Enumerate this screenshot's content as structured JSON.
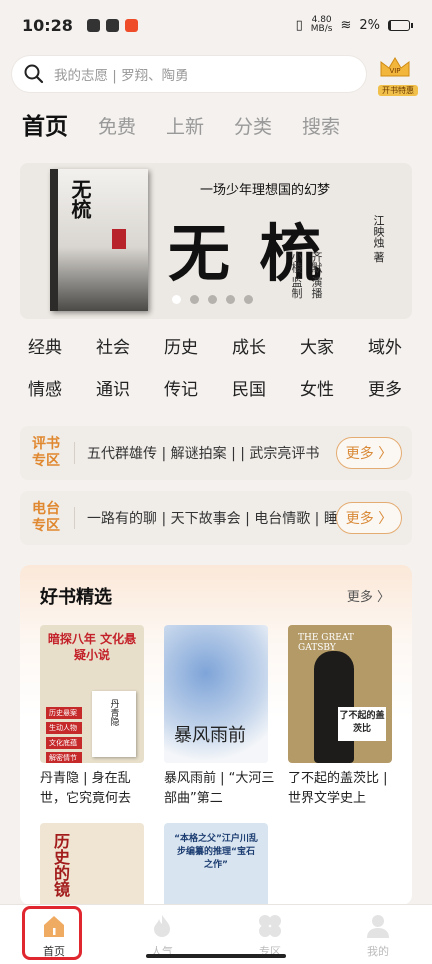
{
  "status": {
    "time": "10:28",
    "net_speed": "4.80",
    "net_unit": "MB/s",
    "battery": "2%"
  },
  "search": {
    "placeholder": "我的志愿 | 罗翔、陶勇"
  },
  "vip": {
    "label": "开书特惠",
    "badge": "VIP"
  },
  "tabs": [
    "首页",
    "免费",
    "上新",
    "分类",
    "搜索"
  ],
  "banner": {
    "slogan": "一场少年理想国的幻梦",
    "title": "无 梳",
    "author": "江映烛 著",
    "credits": [
      "小棱 监制",
      "齐默 演播"
    ],
    "cover_title": "无梳",
    "dots": 5,
    "active_dot": 0
  },
  "categories": [
    "经典",
    "社会",
    "历史",
    "成长",
    "大家",
    "域外",
    "情感",
    "通识",
    "传记",
    "民国",
    "女性",
    "更多"
  ],
  "pingshu": {
    "badge": "评书专区",
    "text": "五代群雄传 | 解谜拍案 | | 武宗亮评书",
    "more": "更多 〉"
  },
  "diantai": {
    "badge": "电台专区",
    "text": "一路有的聊 | 天下故事会 | 电台情歌 | 睡",
    "more": "更多 〉"
  },
  "good_books": {
    "title": "好书精选",
    "more": "更多 〉",
    "books": [
      {
        "caption": "丹青隐 | 身在乱世，它究竟何去",
        "cover_title": "暗探八年 文化悬疑小说",
        "cover_sub": "丹青隐",
        "tags": [
          "历史悬案",
          "生动人物",
          "文化底蕴",
          "解密情节"
        ]
      },
      {
        "caption": "暴风雨前 | “大河三部曲”第二",
        "cover_title": "暴风雨前"
      },
      {
        "caption": "了不起的盖茨比 | 世界文学史上",
        "cover_title": "THE GREAT GATSBY",
        "cover_label": "了不起的盖茨比"
      },
      {
        "caption": "",
        "cover_title": "历史的镜"
      },
      {
        "caption": "",
        "cover_title": "“本格之父”江户川乱步编纂的推理“宝石之作”"
      }
    ]
  },
  "nav": [
    {
      "label": "首页",
      "icon": "home-icon",
      "active": true
    },
    {
      "label": "人气",
      "icon": "flame-icon",
      "active": false
    },
    {
      "label": "专区",
      "icon": "grid-icon",
      "active": false
    },
    {
      "label": "我的",
      "icon": "person-icon",
      "active": false
    }
  ]
}
